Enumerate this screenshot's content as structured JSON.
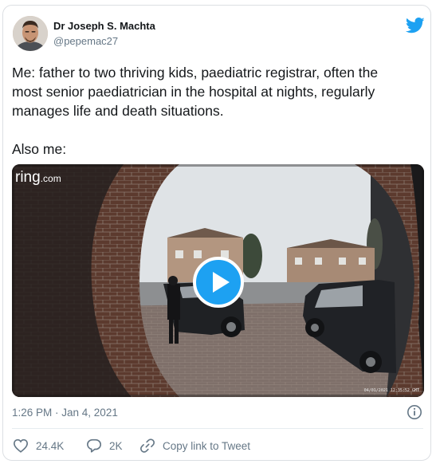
{
  "author": {
    "name": "Dr Joseph S. Machta",
    "handle": "@pepemac27"
  },
  "tweet": {
    "lines": [
      "Me: father to two thriving kids, paediatric registrar, often the",
      "most senior paediatrician in the hospital at nights, regularly",
      "manages life and death situations."
    ],
    "second_paragraph": "Also me:"
  },
  "media": {
    "watermark_brand": "ring",
    "watermark_domain": ".com",
    "camera_timestamp": "04/01/2021 12:35:52 GMT"
  },
  "meta": {
    "time": "1:26 PM · Jan 4, 2021"
  },
  "actions": {
    "likes": "24.4K",
    "replies": "2K",
    "share_label": "Copy link to Tweet"
  },
  "colors": {
    "twitter_blue": "#1da1f2",
    "heart": "#657786",
    "text": "#14171a",
    "secondary_text": "#657786"
  },
  "icons": {
    "brand": "twitter-bird-icon",
    "info": "info-circle-icon",
    "like": "heart-icon",
    "reply": "speech-bubble-icon",
    "share": "link-icon",
    "play": "play-icon"
  }
}
